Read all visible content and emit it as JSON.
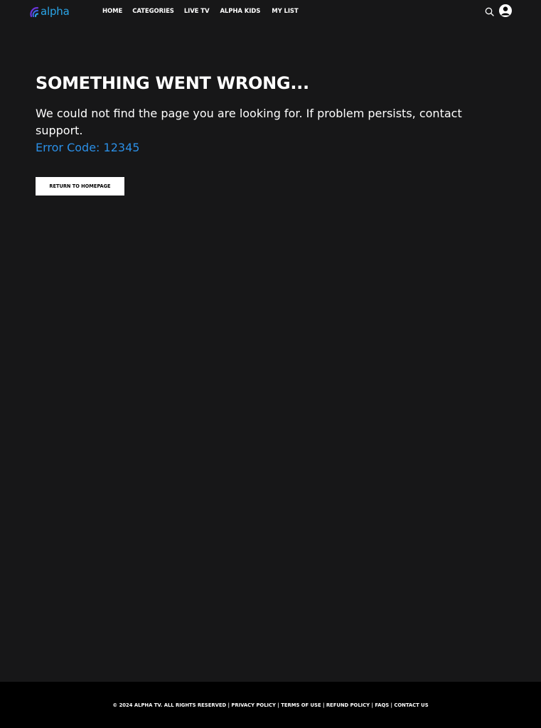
{
  "header": {
    "logo_text": "alpha",
    "nav": [
      {
        "label": "HOME"
      },
      {
        "label": "CATEGORIES"
      },
      {
        "label": "LIVE TV"
      },
      {
        "label": "ALPHA KIDS"
      },
      {
        "label": "MY LIST"
      }
    ],
    "icons": {
      "search": "search-icon",
      "account": "user-avatar-icon"
    }
  },
  "error": {
    "title": "SOMETHING WENT WRONG...",
    "message": "We could not find the page you are looking for. If problem persists, contact support.",
    "code": "Error Code: 12345",
    "button_label": "RETURN TO HOMEPAGE"
  },
  "footer": {
    "copyright": "© 2024 ALPHA TV. ALL RIGHTS RESERVED",
    "separator": "|",
    "links": [
      {
        "label": "PRIVACY POLICY"
      },
      {
        "label": "TERMS OF USE"
      },
      {
        "label": "REFUND POLICY"
      },
      {
        "label": "FAQS"
      },
      {
        "label": "CONTACT US"
      }
    ]
  },
  "colors": {
    "background": "#171718",
    "footer_background": "#000000",
    "accent": "#2b8fe6",
    "logo": "#2aa5e8"
  }
}
